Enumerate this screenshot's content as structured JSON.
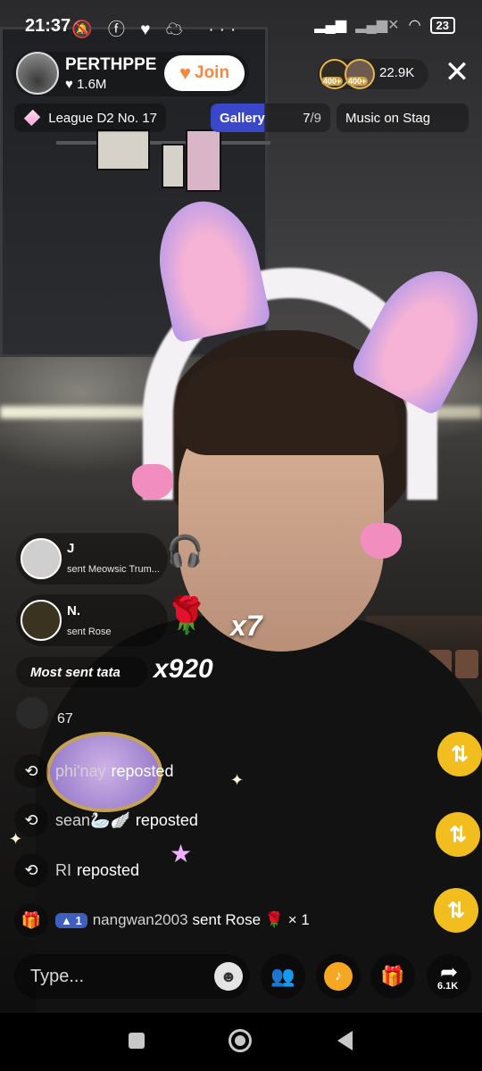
{
  "status_bar": {
    "time": "21:37",
    "left_icons": "🔕ⓕ♥☁ ···",
    "signal": "📶",
    "wifi": "📶",
    "battery": "23"
  },
  "header": {
    "host_name": "PERTHPPE",
    "host_likes": "♥ 1.6M",
    "join_label": "Join",
    "viewer_badges": [
      "400+",
      "400+"
    ],
    "viewer_count": "22.9K",
    "close": "✕"
  },
  "tags": {
    "league": "League D2 No. 17",
    "gallery_label": "Gallery",
    "gallery_count": "7",
    "gallery_total": "/9",
    "music": "Music on Stag"
  },
  "gifts": [
    {
      "name": "J",
      "sub": "sent Meowsic Trum..."
    },
    {
      "name": "N.",
      "sub": "sent Rose",
      "combo": "x7"
    }
  ],
  "most_sent": {
    "label": "Most sent tata",
    "combo": "x920"
  },
  "small_entry": {
    "count": "67"
  },
  "reposts": [
    {
      "name": "phi'nay",
      "verb": "reposted"
    },
    {
      "name": "sean🦢🪽",
      "verb": "reposted"
    },
    {
      "name": "RI",
      "verb": "reposted"
    }
  ],
  "gift_message": {
    "level": "1",
    "user": "nangwan2003",
    "text": "sent Rose 🌹 × 1"
  },
  "toolbar": {
    "placeholder": "Type...",
    "share_count": "6.1K"
  },
  "colors": {
    "join": "#f5893f",
    "gallery": "#3b47c9",
    "repost_fab": "#f2be1f"
  }
}
